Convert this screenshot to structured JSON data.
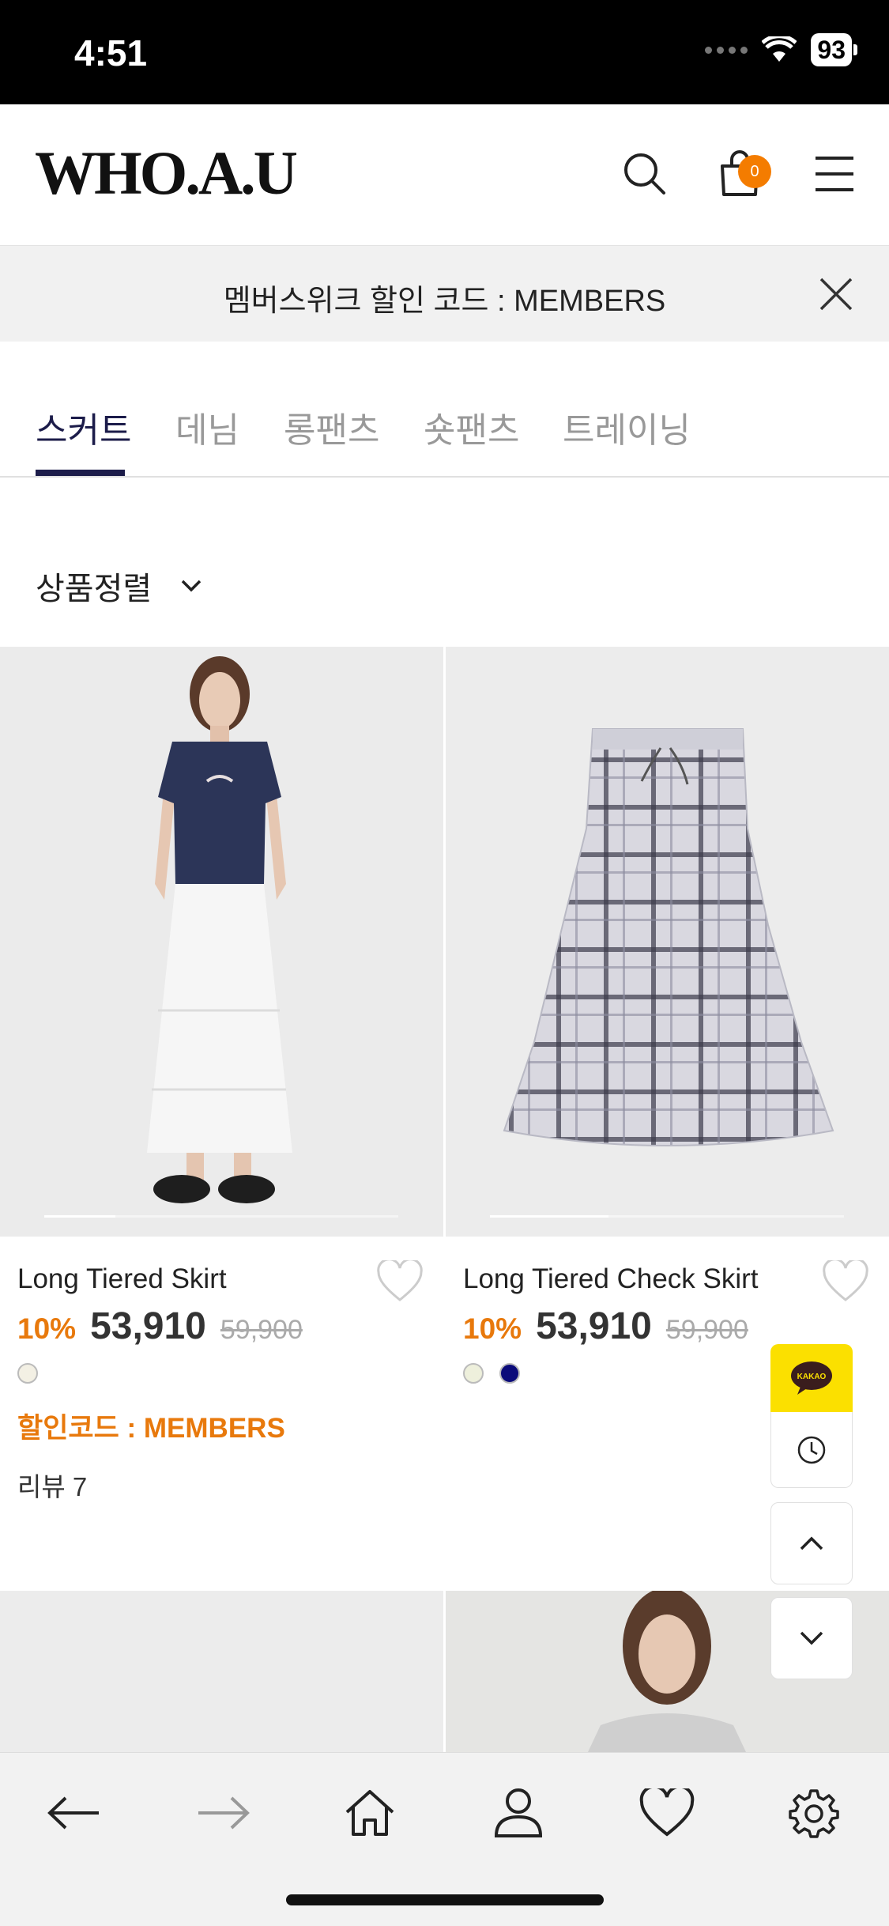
{
  "status_bar": {
    "time": "4:51",
    "battery": "93"
  },
  "header": {
    "logo": "WHO.A.U",
    "cart_count": "0"
  },
  "promo": {
    "text": "멤버스위크 할인 코드 : MEMBERS"
  },
  "tabs": [
    {
      "label": "스커트",
      "active": true
    },
    {
      "label": "데님",
      "active": false
    },
    {
      "label": "롱팬츠",
      "active": false
    },
    {
      "label": "숏팬츠",
      "active": false
    },
    {
      "label": "트레이닝",
      "active": false
    }
  ],
  "sort": {
    "label": "상품정렬"
  },
  "products": [
    {
      "name": "Long Tiered Skirt",
      "discount": "10%",
      "price": "53,910",
      "original_price": "59,900",
      "swatches": [
        "#f3f0e4"
      ],
      "coupon": "할인코드 : MEMBERS",
      "reviews": "리뷰 7"
    },
    {
      "name": "Long Tiered Check Skirt",
      "discount": "10%",
      "price": "53,910",
      "original_price": "59,900",
      "swatches": [
        "#eef0dc",
        "#0b0b7a"
      ]
    }
  ],
  "floating": {
    "kakao_label": "KAKAO"
  },
  "colors": {
    "accent": "#e8790c",
    "badge": "#f47c00",
    "tab_active": "#1c1c4a",
    "kakao": "#fbe000"
  }
}
